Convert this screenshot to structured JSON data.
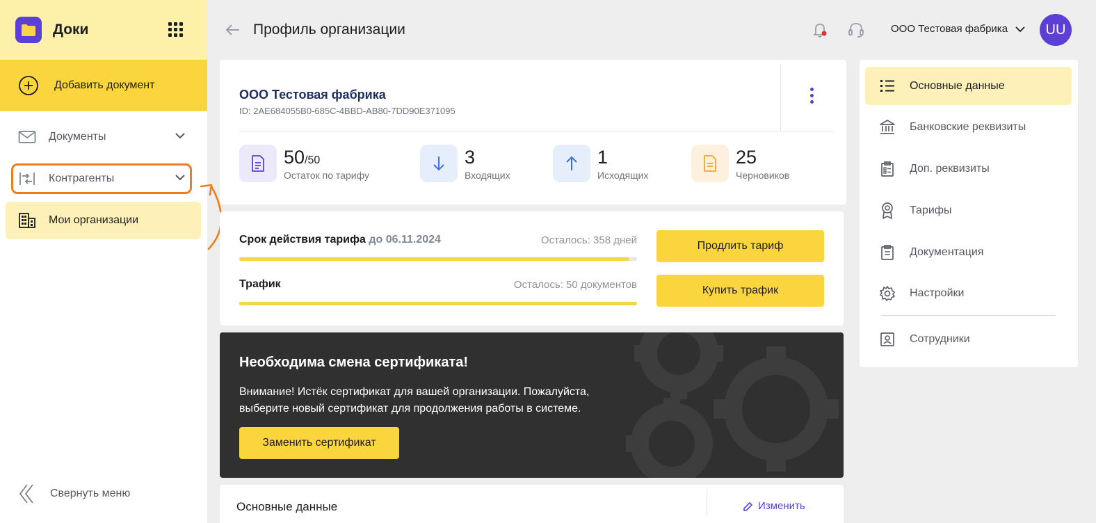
{
  "app": {
    "name": "Доки"
  },
  "sidebar": {
    "add_document": "Добавить документ",
    "items": [
      {
        "label": "Документы",
        "icon": "mail-icon"
      },
      {
        "label": "Контрагенты",
        "icon": "counterparties-icon"
      },
      {
        "label": "Мои организации",
        "icon": "building-icon"
      }
    ],
    "collapse": "Свернуть меню"
  },
  "header": {
    "title": "Профиль организации",
    "org_selector": "ООО Тестовая фабрика",
    "avatar_initials": "UU"
  },
  "org": {
    "name": "ООО Тестовая фабрика",
    "id_text": "ID: 2AE684055B0-685C-4BBD-AB80-7DD90E371095",
    "stats": [
      {
        "value": "50",
        "total": "/50",
        "label": "Остаток по тарифу",
        "icon": "document-icon"
      },
      {
        "value": "3",
        "label": "Входящих",
        "icon": "arrow-down-icon"
      },
      {
        "value": "1",
        "label": "Исходящих",
        "icon": "arrow-up-icon"
      },
      {
        "value": "25",
        "label": "Черновиков",
        "icon": "draft-icon"
      }
    ]
  },
  "tariff": {
    "validity_label": "Срок действия тарифа",
    "validity_date": "до 06.11.2024",
    "validity_remaining": "Осталось: 358 дней",
    "validity_progress": 0.98,
    "traffic_label": "Трафик",
    "traffic_remaining": "Осталось: 50 документов",
    "traffic_progress": 1.0,
    "extend_button": "Продлить тариф",
    "buy_button": "Купить трафик"
  },
  "certificate": {
    "title": "Необходима смена сертификата!",
    "text": "Внимание! Истёк сертификат для вашей организации. Пожалуйста, выберите новый сертификат для продолжения работы в системе.",
    "button": "Заменить сертификат"
  },
  "basic_section": {
    "title": "Основные данные",
    "edit": "Изменить"
  },
  "right_menu": {
    "items": [
      {
        "label": "Основные данные",
        "icon": "list-icon"
      },
      {
        "label": "Банковские реквизиты",
        "icon": "bank-icon"
      },
      {
        "label": "Доп. реквизиты",
        "icon": "clipboard-icon"
      },
      {
        "label": "Тарифы",
        "icon": "badge-icon"
      },
      {
        "label": "Документация",
        "icon": "doc-clipboard-icon"
      },
      {
        "label": "Настройки",
        "icon": "gear-icon"
      },
      {
        "label": "Сотрудники",
        "icon": "user-card-icon"
      }
    ]
  },
  "colors": {
    "accent": "#fbd53d",
    "brand": "#5b3fd6",
    "highlight": "#f07d1c"
  }
}
